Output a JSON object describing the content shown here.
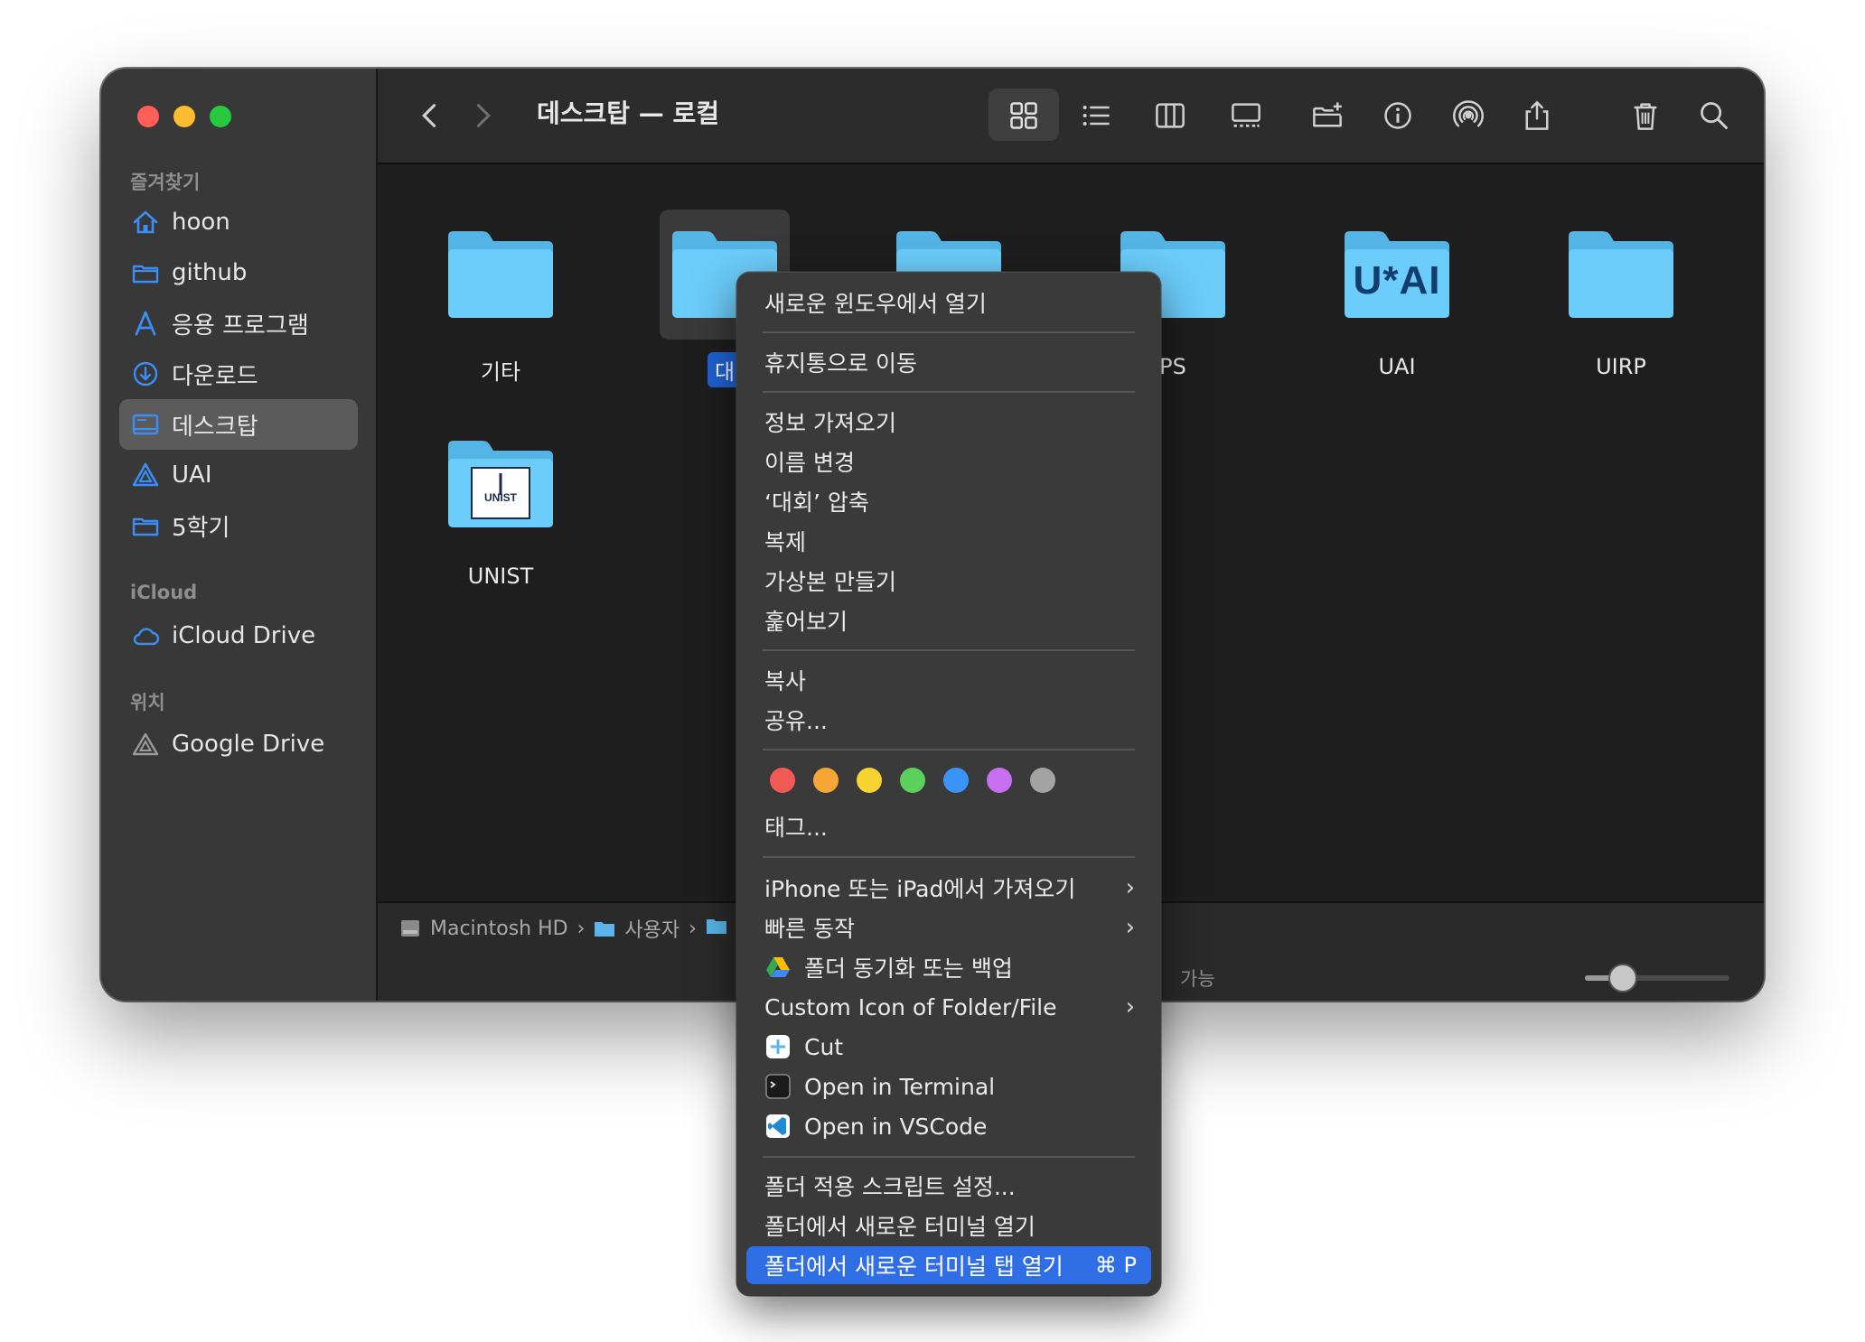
{
  "window": {
    "title": "데스크탑 — 로컬"
  },
  "sidebar": {
    "favorites_label": "즐겨찾기",
    "favorites": [
      {
        "label": "hoon",
        "icon": "home-icon"
      },
      {
        "label": "github",
        "icon": "folder-icon"
      },
      {
        "label": "응용 프로그램",
        "icon": "applications-icon"
      },
      {
        "label": "다운로드",
        "icon": "download-icon"
      },
      {
        "label": "데스크탑",
        "icon": "desktop-icon",
        "selected": true
      },
      {
        "label": "UAI",
        "icon": "drive-triangle-icon"
      },
      {
        "label": "5학기",
        "icon": "folder-icon"
      }
    ],
    "icloud_label": "iCloud",
    "icloud": [
      {
        "label": "iCloud Drive",
        "icon": "cloud-icon"
      }
    ],
    "locations_label": "위치",
    "locations": [
      {
        "label": "Google Drive",
        "icon": "google-drive-icon"
      }
    ]
  },
  "files": [
    {
      "name": "기타"
    },
    {
      "name": "대회",
      "visible_label": "대",
      "selected": true
    },
    {
      "name": ""
    },
    {
      "name": "PS"
    },
    {
      "name": "UAI",
      "folder_text": "U*AI"
    },
    {
      "name": "UIRP"
    },
    {
      "name": "UNIST",
      "folder_text": "UNIST"
    }
  ],
  "pathbar": {
    "items": [
      "Macintosh HD",
      "사용자"
    ]
  },
  "status": {
    "text": "가능",
    "icon_size_fraction": 0.25
  },
  "context_menu": {
    "items": [
      "새로운 윈도우에서 열기",
      "휴지통으로 이동",
      "정보 가져오기",
      "이름 변경",
      "‘대회’ 압축",
      "복제",
      "가상본 만들기",
      "훑어보기",
      "복사",
      "공유...",
      "태그...",
      "iPhone 또는 iPad에서 가져오기",
      "빠른 동작",
      "폴더 동기화 또는 백업",
      "Custom Icon of Folder/File",
      "Cut",
      "Open in Terminal",
      "Open in VSCode",
      "폴더 적용 스크립트 설정...",
      "폴더에서 새로운 터미널 열기",
      "폴더에서 새로운 터미널 탭 열기"
    ],
    "shortcut": "⌘ P",
    "tag_colors": [
      "#f25a55",
      "#f7a534",
      "#f8d433",
      "#5cd05c",
      "#3a94f7",
      "#c86ef0",
      "#a3a3a3"
    ]
  },
  "colors": {
    "folder": "#5ac8fa",
    "accent": "#2f6ee4"
  }
}
